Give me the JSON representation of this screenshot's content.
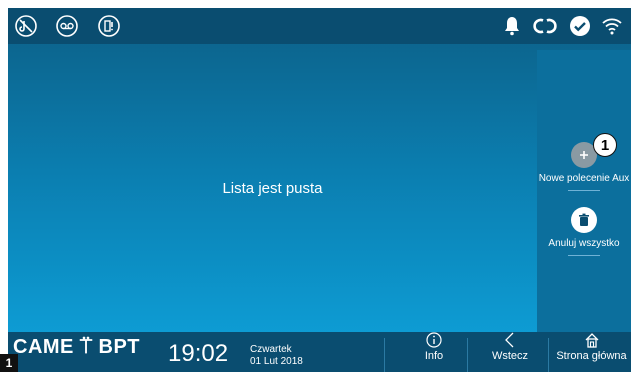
{
  "status_bar": {
    "left_icons": [
      "do-not-disturb-icon",
      "voicemail-icon",
      "door-intercom-icon"
    ],
    "right_icons": [
      "bell-icon",
      "link-icon",
      "check-circle-icon",
      "wifi-icon"
    ]
  },
  "main": {
    "empty_message": "Lista jest pusta"
  },
  "side_panel": {
    "add_label": "Nowe polecenie Aux",
    "delete_label": "Anuluj wszystko"
  },
  "callout": "1",
  "bottom_bar": {
    "logo": "CAME ⍡ BPT",
    "time": "19:02",
    "day": "Czwartek",
    "date": "01 Lut 2018",
    "info_label": "Info",
    "back_label": "Wstecz",
    "home_label": "Strona główna"
  },
  "page_badge": "1"
}
